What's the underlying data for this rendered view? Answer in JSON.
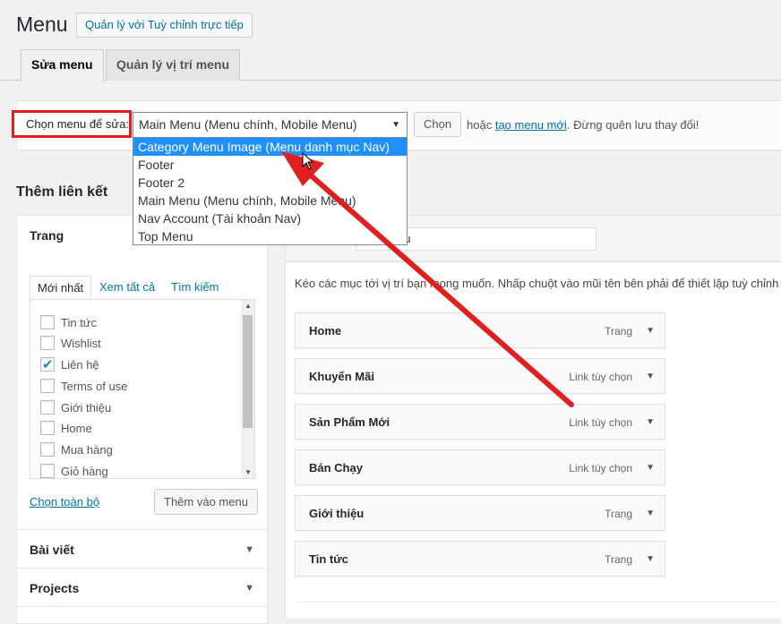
{
  "header": {
    "title": "Menu",
    "live_manage_label": "Quản lý với Tuỳ chỉnh trực tiếp"
  },
  "tabs": [
    {
      "label": "Sửa menu",
      "active": true
    },
    {
      "label": "Quản lý vị trí menu",
      "active": false
    }
  ],
  "select_bar": {
    "label": "Chọn menu để sửa:",
    "selected_value": "Main Menu (Menu chính, Mobile Menu)",
    "choose_button": "Chọn",
    "or_text": "hoặc",
    "create_link": "tạo menu mới",
    "reminder": ". Đừng quên lưu thay đổi!"
  },
  "dropdown": {
    "options": [
      {
        "label": "Category Menu Image (Menu danh mục Nav)",
        "highlighted": true
      },
      {
        "label": "Footer",
        "highlighted": false
      },
      {
        "label": "Footer 2",
        "highlighted": false
      },
      {
        "label": "Main Menu (Menu chính, Mobile Menu)",
        "highlighted": false
      },
      {
        "label": "Nav Account (Tài khoản Nav)",
        "highlighted": false
      },
      {
        "label": "Top Menu",
        "highlighted": false
      }
    ]
  },
  "add_links": {
    "title": "Thêm liên kết",
    "pages_panel": {
      "title": "Trang",
      "tabs": [
        "Mới nhất",
        "Xem tất cả",
        "Tìm kiếm"
      ],
      "items": [
        {
          "label": "Tin tức",
          "checked": false
        },
        {
          "label": "Wishlist",
          "checked": false
        },
        {
          "label": "Liên hệ",
          "checked": true
        },
        {
          "label": "Terms of use",
          "checked": false
        },
        {
          "label": "Giới thiệu",
          "checked": false
        },
        {
          "label": "Home",
          "checked": false
        },
        {
          "label": "Mua hàng",
          "checked": false
        },
        {
          "label": "Giỏ hàng",
          "checked": false
        }
      ],
      "select_all": "Chọn toàn bộ",
      "add_button": "Thêm vào menu"
    },
    "posts_panel": {
      "title": "Bài viết"
    },
    "projects_panel": {
      "title": "Projects"
    }
  },
  "menu_structure": {
    "menu_name_visible": "nu",
    "hint": "Kéo các mục tới vị trí bạn mong muốn. Nhấp chuột vào mũi tên bên phải để thiết lập tuỳ chỉnh",
    "items": [
      {
        "title": "Home",
        "type": "Trang"
      },
      {
        "title": "Khuyến Mãi",
        "type": "Link tùy chọn"
      },
      {
        "title": "Sản Phẩm Mới",
        "type": "Link tùy chọn"
      },
      {
        "title": "Bán Chạy",
        "type": "Link tùy chọn"
      },
      {
        "title": "Giới thiệu",
        "type": "Trang"
      },
      {
        "title": "Tin tức",
        "type": "Trang"
      }
    ]
  },
  "icons": {
    "dropdown_caret": "▼",
    "panel_arrow": "▼",
    "item_arrow": "▼",
    "check": "✔"
  },
  "colors": {
    "highlight_blue": "#1e90ff",
    "link_blue": "#0073aa",
    "annotation_red": "#e02020"
  }
}
